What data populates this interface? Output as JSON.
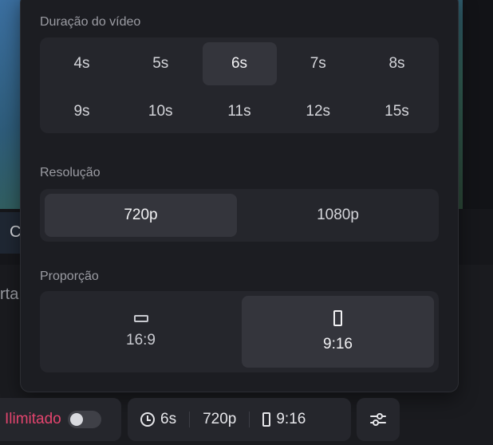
{
  "background": {
    "tab_letter": "C",
    "side_text": "rta"
  },
  "popover": {
    "duration": {
      "label": "Duração do vídeo",
      "options": [
        "4s",
        "5s",
        "6s",
        "7s",
        "8s",
        "9s",
        "10s",
        "11s",
        "12s",
        "15s"
      ],
      "selected": "6s"
    },
    "resolution": {
      "label": "Resolução",
      "options": [
        "720p",
        "1080p"
      ],
      "selected": "720p"
    },
    "ratio": {
      "label": "Proporção",
      "options": [
        {
          "label": "16:9",
          "icon": "landscape-ratio-icon"
        },
        {
          "label": "9:16",
          "icon": "portrait-ratio-icon"
        }
      ],
      "selected": "9:16"
    }
  },
  "toolbar": {
    "unlimited_label": "Ilimitado",
    "unlimited_enabled": false,
    "duration_value": "6s",
    "resolution_value": "720p",
    "ratio_value": "9:16",
    "icons": [
      "clock-icon",
      "portrait-ratio-icon",
      "sliders-icon"
    ]
  },
  "colors": {
    "accent_red": "#e3446e",
    "panel": "#25262c",
    "selected": "#34353c"
  }
}
